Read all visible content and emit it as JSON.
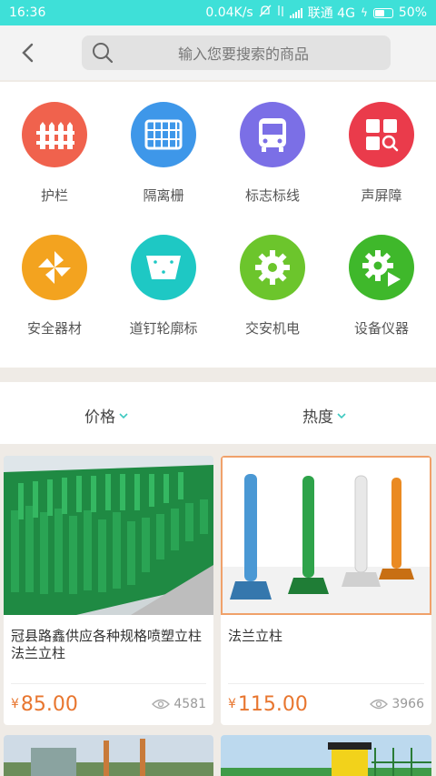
{
  "status": {
    "time": "16:36",
    "net_speed": "0.04K/s",
    "carrier": "联通 4G",
    "battery": "50%"
  },
  "search": {
    "placeholder": "输入您要搜索的商品"
  },
  "categories": [
    {
      "label": "护栏",
      "icon": "fence-icon",
      "color": "#f0624d"
    },
    {
      "label": "隔离栅",
      "icon": "grid-fence-icon",
      "color": "#3e97e9"
    },
    {
      "label": "标志标线",
      "icon": "bus-icon",
      "color": "#7b6fe6"
    },
    {
      "label": "声屏障",
      "icon": "panel-search-icon",
      "color": "#ea3b4b"
    },
    {
      "label": "安全器材",
      "icon": "pinwheel-icon",
      "color": "#f3a31f"
    },
    {
      "label": "道钉轮廓标",
      "icon": "road-stud-icon",
      "color": "#1ec8c4"
    },
    {
      "label": "交安机电",
      "icon": "gear-icon",
      "color": "#6cc52c"
    },
    {
      "label": "设备仪器",
      "icon": "gear-play-icon",
      "color": "#3fb82b"
    }
  ],
  "sort": {
    "price_label": "价格",
    "hot_label": "热度",
    "accent": "#3ec9c0"
  },
  "products": [
    {
      "title": "冠县路鑫供应各种规格喷塑立柱法兰立柱",
      "price_symbol": "¥",
      "price": "85.00",
      "views": "4581"
    },
    {
      "title": "法兰立柱",
      "price_symbol": "¥",
      "price": "115.00",
      "views": "3966"
    }
  ]
}
